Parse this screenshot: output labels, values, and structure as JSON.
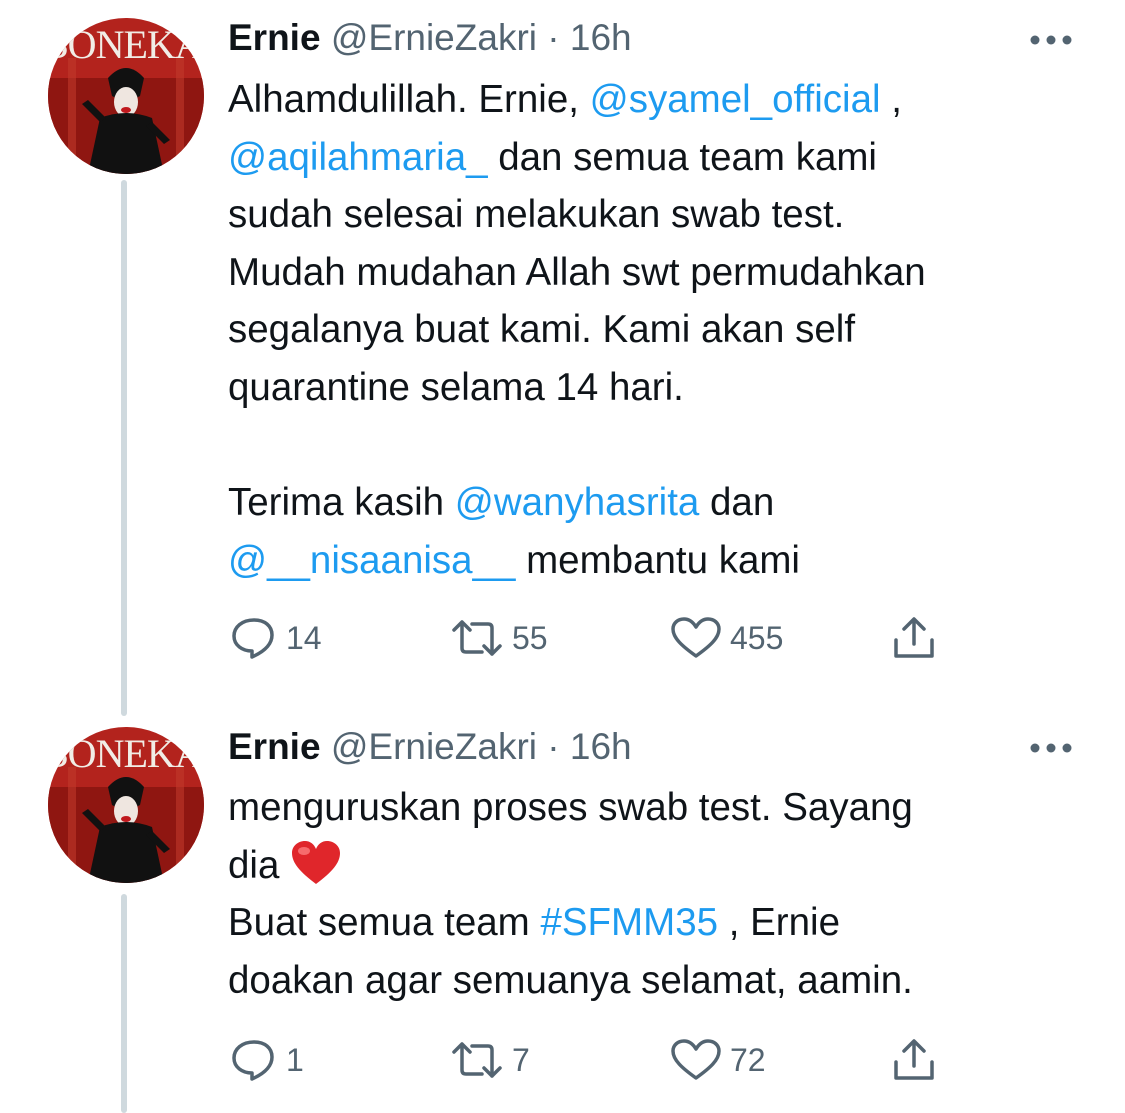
{
  "tweets": [
    {
      "display_name": "Ernie",
      "handle": "@ErnieZakri",
      "separator": "·",
      "time": "16h",
      "avatar_text": "BONEKA",
      "body_lines": [
        [
          {
            "t": "Alhamdulillah. Ernie, "
          },
          {
            "t": "@syamel_official",
            "link": true
          },
          {
            "t": " ,"
          }
        ],
        [
          {
            "t": "@aqilahmaria_",
            "link": true
          },
          {
            "t": " dan semua team kami"
          }
        ],
        [
          {
            "t": "sudah selesai melakukan swab test."
          }
        ],
        [
          {
            "t": "Mudah mudahan Allah swt permudahkan"
          }
        ],
        [
          {
            "t": "segalanya buat kami. Kami akan self"
          }
        ],
        [
          {
            "t": "quarantine selama 14 hari."
          }
        ],
        [],
        [
          {
            "t": "Terima kasih "
          },
          {
            "t": "@wanyhasrita",
            "link": true
          },
          {
            "t": " dan"
          }
        ],
        [
          {
            "t": "@__nisaanisa__",
            "link": true
          },
          {
            "t": " membantu kami"
          }
        ]
      ],
      "replies": "14",
      "retweets": "55",
      "likes": "455"
    },
    {
      "display_name": "Ernie",
      "handle": "@ErnieZakri",
      "separator": "·",
      "time": "16h",
      "avatar_text": "BONEKA",
      "body_lines": [
        [
          {
            "t": "menguruskan proses swab test. Sayang"
          }
        ],
        [
          {
            "t": "dia "
          },
          {
            "emoji": "heart"
          }
        ],
        [
          {
            "t": "Buat semua team "
          },
          {
            "t": "#SFMM35",
            "link": true
          },
          {
            "t": " , Ernie"
          }
        ],
        [
          {
            "t": "doakan agar semuanya selamat, aamin."
          }
        ]
      ],
      "replies": "1",
      "retweets": "7",
      "likes": "72"
    }
  ],
  "icons": {
    "more": "more-horizontal-icon",
    "reply": "reply-icon",
    "retweet": "retweet-icon",
    "like": "like-icon",
    "share": "share-icon",
    "heart_emoji": "red-heart-emoji"
  },
  "colors": {
    "link": "#1d9bf0",
    "secondary_text": "#536471",
    "thread_line": "#cfd9de",
    "heart_emoji": "#e0262b"
  }
}
